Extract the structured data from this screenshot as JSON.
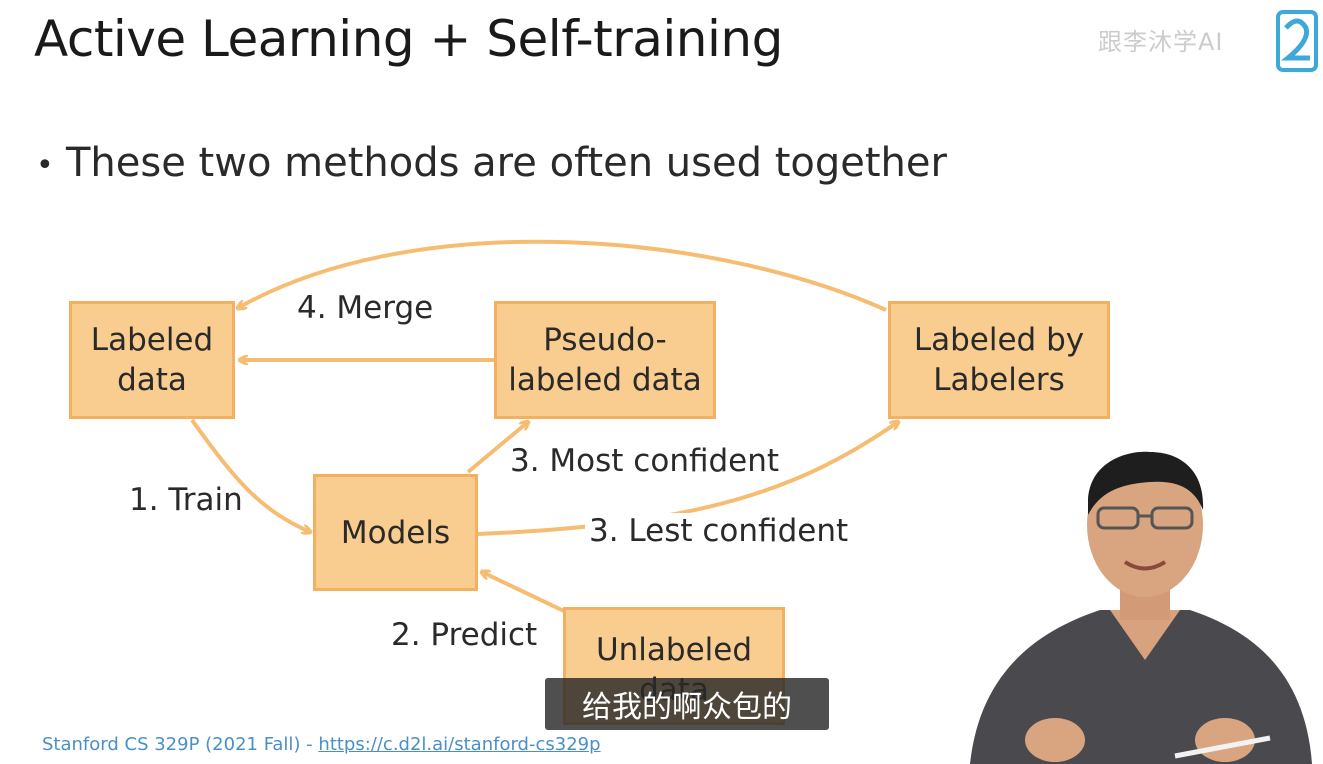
{
  "slide": {
    "title": "Active Learning + Self-training",
    "bullet": "These two methods are often used together",
    "footer_prefix": "Stanford CS 329P (2021 Fall) - ",
    "footer_link": "https://c.d2l.ai/stanford-cs329p"
  },
  "watermark": "跟李沐学AI",
  "diagram": {
    "boxes": {
      "labeled_data": "Labeled\ndata",
      "pseudo_labeled": "Pseudo-\nlabeled data",
      "labeled_by_labelers": "Labeled by\nLabelers",
      "models": "Models",
      "unlabeled": "Unlabeled\ndata"
    },
    "edges": {
      "train": "1. Train",
      "predict": "2. Predict",
      "most_confident": "3. Most confident",
      "lest_confident": "3. Lest confident",
      "merge": "4. Merge"
    }
  },
  "video_subtitle": "给我的啊众包的",
  "colors": {
    "box_fill": "#f9cd8f",
    "box_border": "#f4b061",
    "arrow": "#f6bd72",
    "link": "#4a8fc9"
  }
}
